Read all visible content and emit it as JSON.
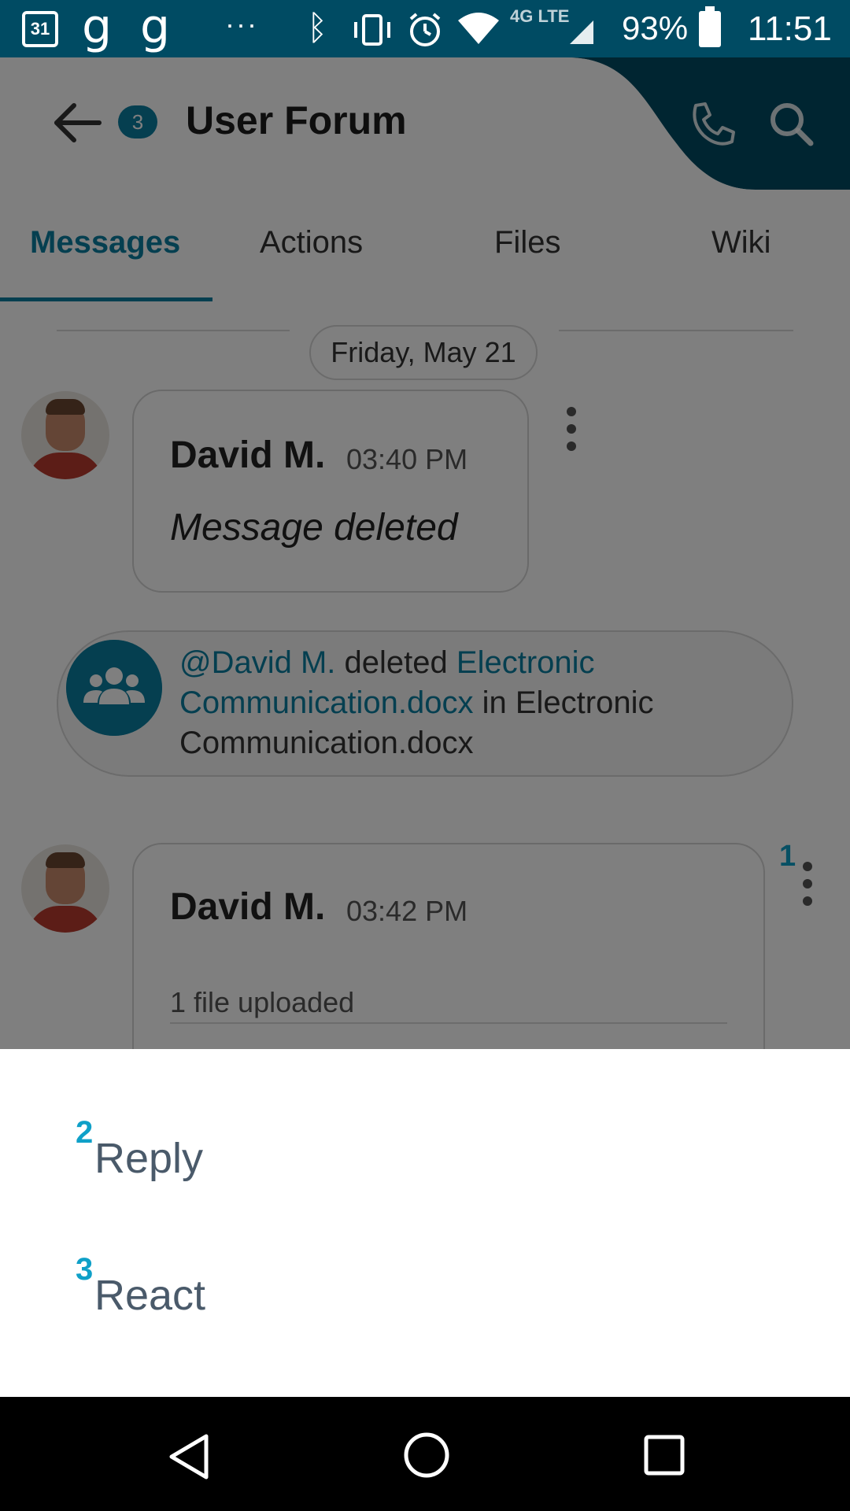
{
  "status_bar": {
    "calendar_day": "31",
    "app_icon_1": "g",
    "app_icon_2": "g",
    "more": "···",
    "network_label": "4G LTE",
    "battery_percent": "93%",
    "time": "11:51",
    "icons": [
      "calendar-icon",
      "g-icon",
      "g-icon",
      "more-icon",
      "bluetooth-icon",
      "vibrate-icon",
      "alarm-icon",
      "wifi-icon",
      "signal-icon",
      "battery-icon"
    ]
  },
  "header": {
    "badge_count": "3",
    "title": "User Forum",
    "accent_color": "#004b63"
  },
  "tabs": [
    {
      "label": "Messages",
      "active": true
    },
    {
      "label": "Actions",
      "active": false
    },
    {
      "label": "Files",
      "active": false
    },
    {
      "label": "Wiki",
      "active": false
    }
  ],
  "chat": {
    "day_separator": "Friday, May 21",
    "messages": [
      {
        "author": "David M.",
        "time": "03:40 PM",
        "text": "Message deleted"
      },
      {
        "author": "David M.",
        "time": "03:42 PM",
        "file_note": "1 file uploaded"
      }
    ],
    "system_event": {
      "mention": "@David M.",
      "action": " deleted ",
      "file_link": "Electronic Communication.docx",
      "suffix": " in Electronic Communication.docx"
    },
    "hint_1": "1"
  },
  "sheet": {
    "items": [
      {
        "number": "2",
        "label": "Reply"
      },
      {
        "number": "3",
        "label": "React"
      }
    ]
  },
  "colors": {
    "primary": "#0b7fa0",
    "hint": "#0fa0c8",
    "status_bar": "#004b63"
  }
}
